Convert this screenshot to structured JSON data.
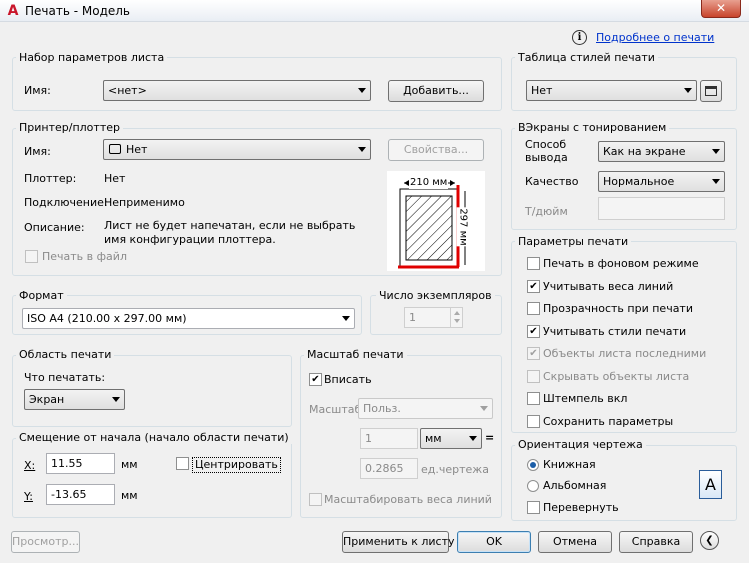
{
  "window": {
    "title": "Печать - Модель",
    "close": "✕"
  },
  "help": {
    "icon": "info-icon",
    "link": "Подробнее о печати"
  },
  "page_setup": {
    "group": "Набор параметров листа",
    "name_label": "Имя:",
    "name_value": "<нет>",
    "add_button": "Добавить..."
  },
  "printer": {
    "group": "Принтер/плоттер",
    "name_label": "Имя:",
    "name_value": "Нет",
    "properties_button": "Свойства...",
    "plotter_label": "Плоттер:",
    "plotter_value": "Нет",
    "connection_label": "Подключение:",
    "connection_value": "Неприменимо",
    "description_label": "Описание:",
    "description_value": "Лист не будет напечатан, если не выбрать имя конфигурации плоттера.",
    "print_to_file": "Печать в файл",
    "preview_width": "210 мм",
    "preview_height": "297 мм"
  },
  "paper_size": {
    "group": "Формат",
    "value": "ISO A4 (210.00 x 297.00 мм)"
  },
  "copies": {
    "group": "Число экземпляров",
    "value": "1"
  },
  "plot_area": {
    "group": "Область печати",
    "what_label": "Что печатать:",
    "what_value": "Экран"
  },
  "plot_offset": {
    "group": "Смещение от начала (начало области печати)",
    "x_label": "X:",
    "x_value": "11.55",
    "x_unit": "мм",
    "y_label": "Y:",
    "y_value": "-13.65",
    "y_unit": "мм",
    "center": "Центрировать"
  },
  "plot_scale": {
    "group": "Масштаб печати",
    "fit": "Вписать",
    "scale_label": "Масштаб:",
    "scale_value": "Польз.",
    "value1": "1",
    "unit1": "мм",
    "equals": "=",
    "value2": "0.2865",
    "unit2": "ед.чертежа",
    "lineweights": "Масштабировать веса линий"
  },
  "style_table": {
    "group": "Таблица стилей печати",
    "value": "Нет",
    "edit_icon": "edit-table-icon"
  },
  "shaded": {
    "group": "ВЭкраны с тонированием",
    "method_label": "Способ вывода",
    "method_value": "Как на экране",
    "quality_label": "Качество",
    "quality_value": "Нормальное",
    "dpi_label": "Т/дюйм"
  },
  "options": {
    "group": "Параметры печати",
    "items": [
      {
        "label": "Печать в фоновом режиме",
        "checked": false,
        "disabled": false
      },
      {
        "label": "Учитывать веса линий",
        "checked": true,
        "disabled": false
      },
      {
        "label": "Прозрачность при печати",
        "checked": false,
        "disabled": false
      },
      {
        "label": "Учитывать стили печати",
        "checked": true,
        "disabled": false
      },
      {
        "label": "Объекты листа последними",
        "checked": true,
        "disabled": true
      },
      {
        "label": "Скрывать объекты листа",
        "checked": false,
        "disabled": true
      },
      {
        "label": "Штемпель вкл",
        "checked": false,
        "disabled": false
      },
      {
        "label": "Сохранить параметры",
        "checked": false,
        "disabled": false
      }
    ]
  },
  "orientation": {
    "group": "Ориентация чертежа",
    "portrait": "Книжная",
    "landscape": "Альбомная",
    "upside": "Перевернуть",
    "icon_letter": "A"
  },
  "buttons": {
    "preview": "Просмотр...",
    "apply": "Применить к листу",
    "ok": "OK",
    "cancel": "Отмена",
    "help": "Справка",
    "collapse": "❮"
  }
}
